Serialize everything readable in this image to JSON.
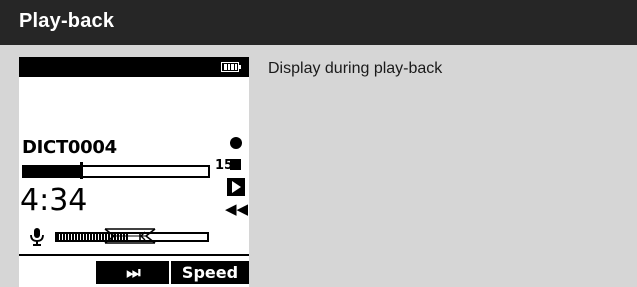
{
  "header": {
    "title": "Play-back"
  },
  "caption": "Display during play-back",
  "device": {
    "file_name": "DICT0004",
    "file_total_label": "15",
    "playback_progress": 0.31,
    "elapsed_time": "4:34",
    "input_level": 0.48,
    "softkeys": {
      "skip_label": "⏭",
      "speed_label": "Speed"
    }
  },
  "colors": {
    "header_bg": "#262626",
    "page_bg": "#d6d6d6",
    "screen_bg": "#ffffff",
    "screen_ink": "#000000"
  },
  "icons": [
    "battery-icon",
    "record-icon",
    "stop-icon",
    "play-icon",
    "rewind-icon",
    "microphone-icon",
    "skip-forward-icon"
  ]
}
